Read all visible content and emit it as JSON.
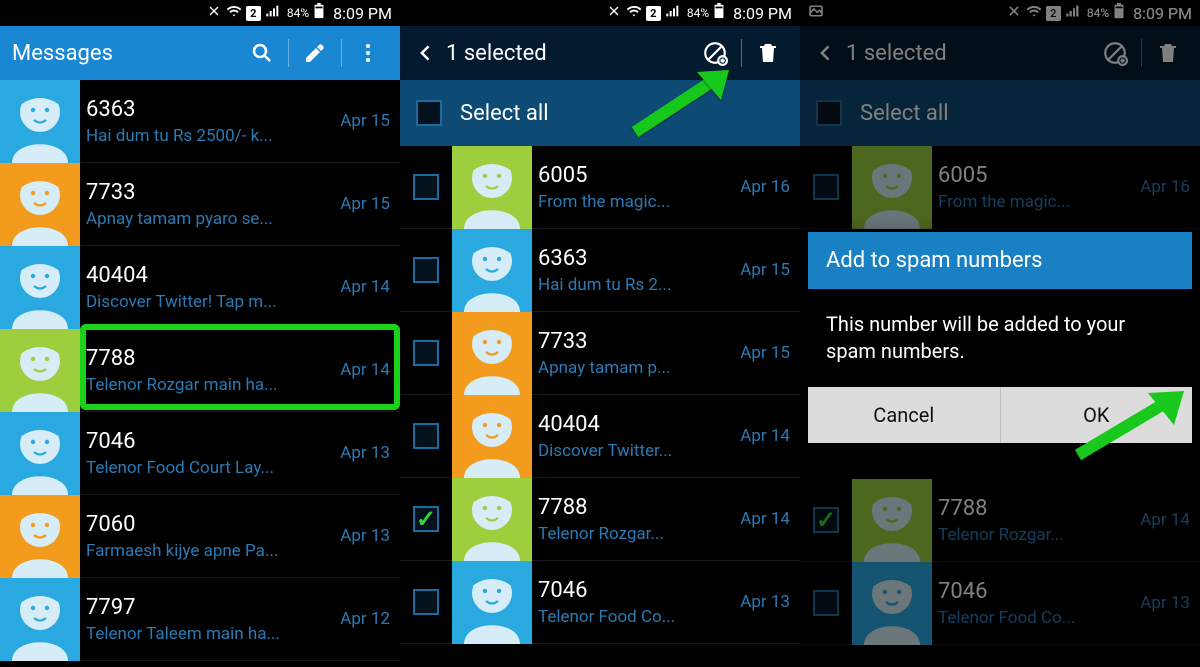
{
  "status": {
    "sim": "2",
    "battery": "84%",
    "time": "8:09 PM"
  },
  "pane1": {
    "title": "Messages",
    "items": [
      {
        "sender": "6363",
        "preview": "Hai dum tu Rs 2500/- k...",
        "date": "Apr 15",
        "avatar": "blue"
      },
      {
        "sender": "7733",
        "preview": "Apnay tamam pyaro se...",
        "date": "Apr 15",
        "avatar": "orange"
      },
      {
        "sender": "40404",
        "preview": "Discover Twitter! Tap m...",
        "date": "Apr 14",
        "avatar": "blue"
      },
      {
        "sender": "7788",
        "preview": "Telenor Rozgar main ha...",
        "date": "Apr 14",
        "avatar": "green"
      },
      {
        "sender": "7046",
        "preview": "Telenor Food Court Lay...",
        "date": "Apr 13",
        "avatar": "blue"
      },
      {
        "sender": "7060",
        "preview": "Farmaesh kijye apne Pa...",
        "date": "Apr 13",
        "avatar": "orange"
      },
      {
        "sender": "7797",
        "preview": "Telenor Taleem main ha...",
        "date": "Apr 12",
        "avatar": "blue"
      }
    ]
  },
  "pane2": {
    "title": "1 selected",
    "select_all": "Select all",
    "items": [
      {
        "sender": "6005",
        "preview": "From the magic...",
        "date": "Apr 16",
        "avatar": "green",
        "checked": false
      },
      {
        "sender": "6363",
        "preview": "Hai dum tu Rs 2...",
        "date": "Apr 15",
        "avatar": "blue",
        "checked": false
      },
      {
        "sender": "7733",
        "preview": "Apnay tamam p...",
        "date": "Apr 15",
        "avatar": "orange",
        "checked": false
      },
      {
        "sender": "40404",
        "preview": "Discover Twitter...",
        "date": "Apr 14",
        "avatar": "orange",
        "checked": false
      },
      {
        "sender": "7788",
        "preview": "Telenor Rozgar...",
        "date": "Apr 14",
        "avatar": "green",
        "checked": true
      },
      {
        "sender": "7046",
        "preview": "Telenor Food Co...",
        "date": "Apr 13",
        "avatar": "blue",
        "checked": false
      }
    ]
  },
  "pane3": {
    "title": "1 selected",
    "select_all": "Select all",
    "items": [
      {
        "sender": "6005",
        "preview": "From the magic...",
        "date": "Apr 16",
        "avatar": "green",
        "checked": false
      },
      {
        "sender": "7788",
        "preview": "Telenor Rozgar...",
        "date": "Apr 14",
        "avatar": "green",
        "checked": true
      },
      {
        "sender": "7046",
        "preview": "Telenor Food Co...",
        "date": "Apr 13",
        "avatar": "blue",
        "checked": false
      }
    ],
    "dialog": {
      "title": "Add to spam numbers",
      "body": "This number will be added to your spam numbers.",
      "cancel": "Cancel",
      "ok": "OK"
    }
  }
}
